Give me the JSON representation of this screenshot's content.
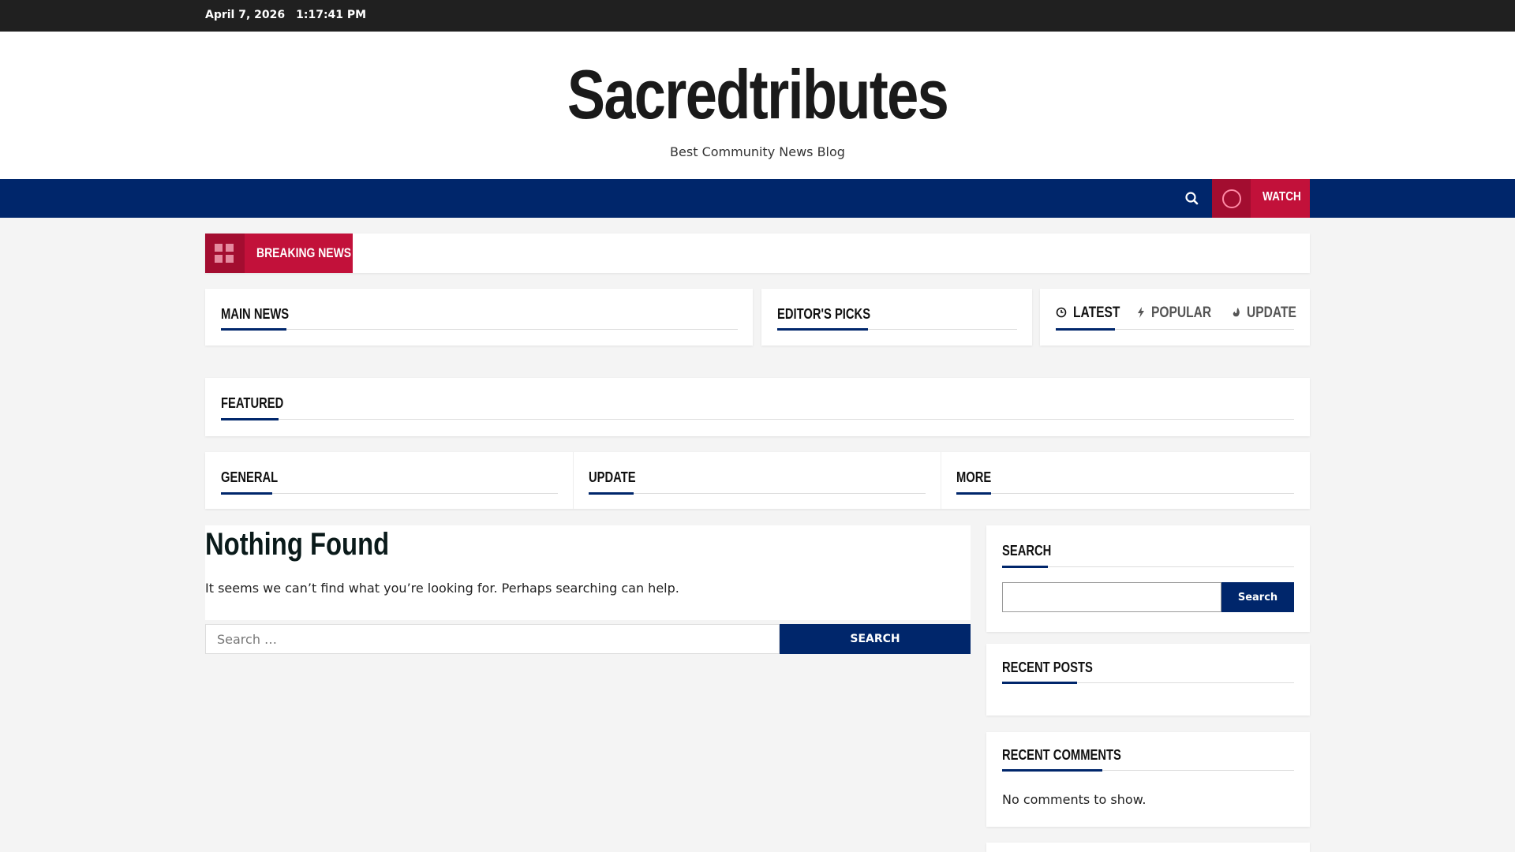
{
  "topbar": {
    "date": "April 7, 2026",
    "time": "1:17:41 PM"
  },
  "site": {
    "title": "Sacredtributes",
    "tagline": "Best Community News Blog"
  },
  "nav": {
    "search_icon": "search-icon",
    "watch_label": "Watch"
  },
  "breaking": {
    "label": "Breaking News",
    "icon": "grid-icon"
  },
  "sections": {
    "main_news": "Main News",
    "editors_picks": "Editor's Picks",
    "featured": "Featured",
    "general": "General",
    "update": "Update",
    "more": "More"
  },
  "tabs": [
    {
      "label": "Latest",
      "icon": "clock-icon",
      "active": true
    },
    {
      "label": "Popular",
      "icon": "bolt-icon",
      "active": false
    },
    {
      "label": "Update",
      "icon": "fire-icon",
      "active": false
    }
  ],
  "not_found": {
    "title": "Nothing Found",
    "message": "It seems we can’t find what you’re looking for. Perhaps searching can help.",
    "search_placeholder": "Search …",
    "search_button": "Search"
  },
  "sidebar": {
    "search_heading": "Search",
    "search_button": "Search",
    "recent_posts_heading": "Recent Posts",
    "recent_comments_heading": "Recent Comments",
    "no_comments": "No comments to show."
  },
  "colors": {
    "navy": "#00266b",
    "red": "#c2113a",
    "dark": "#202020"
  }
}
